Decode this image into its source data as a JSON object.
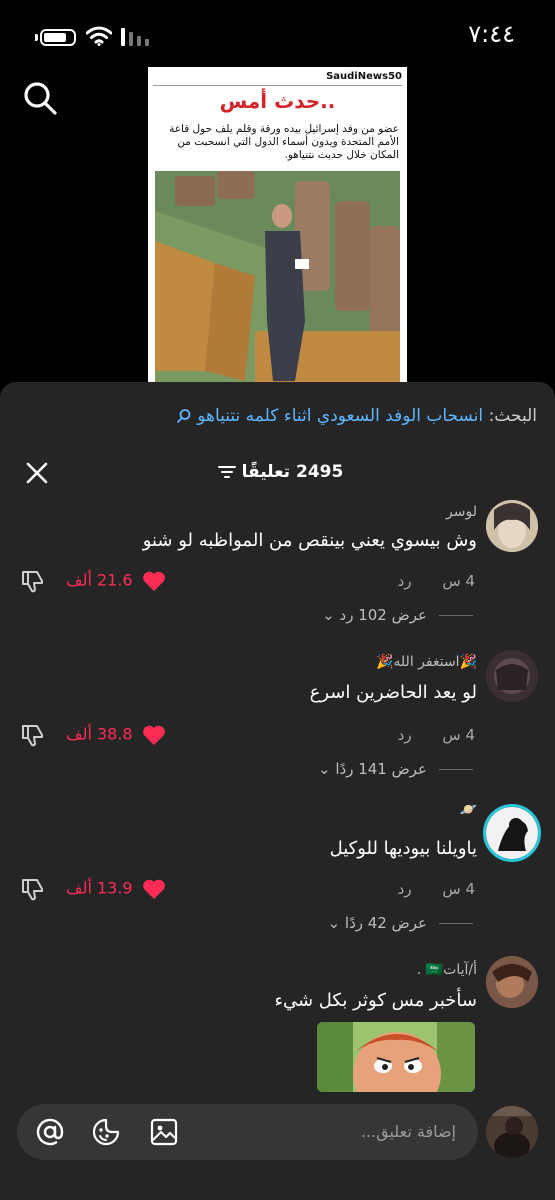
{
  "status_bar": {
    "time": "٧:٤٤"
  },
  "video": {
    "brand": "SaudiNews50",
    "headline": "حدث أمس..",
    "caption": "عضو من وفد إسرائيل بيده ورقة وقلم يلف حول قاعة الأمم المتحدة ويدون أسماء الدول التي انسحبت من المكان خلال حديث نتنياهو."
  },
  "search_hint": {
    "label": "البحث:",
    "query": "انسحاب الوفد السعودي اثناء كلمه نتنياهو"
  },
  "sheet": {
    "comments_count": "2495 تعليقًا"
  },
  "comments": [
    {
      "username": "لوسر",
      "text": "وش بيسوي يعني بينقص من المواظبه لو شنو",
      "time": "4 س",
      "reply_label": "رد",
      "likes": "21.6 ألف",
      "view_replies": "عرض 102 رد"
    },
    {
      "username": "🎉استغفر الله🎉",
      "text": "لو يعد الحاضرين اسرع",
      "time": "4 س",
      "reply_label": "رد",
      "likes": "38.8 ألف",
      "view_replies": "عرض 141 ردًا"
    },
    {
      "username": "🪐",
      "text": "ياويلنا بيوديها للوكيل",
      "time": "4 س",
      "reply_label": "رد",
      "likes": "13.9 ألف",
      "view_replies": "عرض 42 ردًا"
    },
    {
      "username": "أ/آيات🇸🇦 .",
      "text": "سأخبر مس كوثر بكل شيء"
    }
  ],
  "input": {
    "placeholder": "إضافة تعليق..."
  },
  "colors": {
    "sheet_bg": "#252525",
    "like_red": "#fe2c55",
    "search_blue": "#5eb6ff"
  },
  "icons": [
    "search-icon",
    "close-icon",
    "filter-icon",
    "heart-icon",
    "dislike-icon",
    "mention-icon",
    "emoji-icon",
    "image-icon"
  ]
}
